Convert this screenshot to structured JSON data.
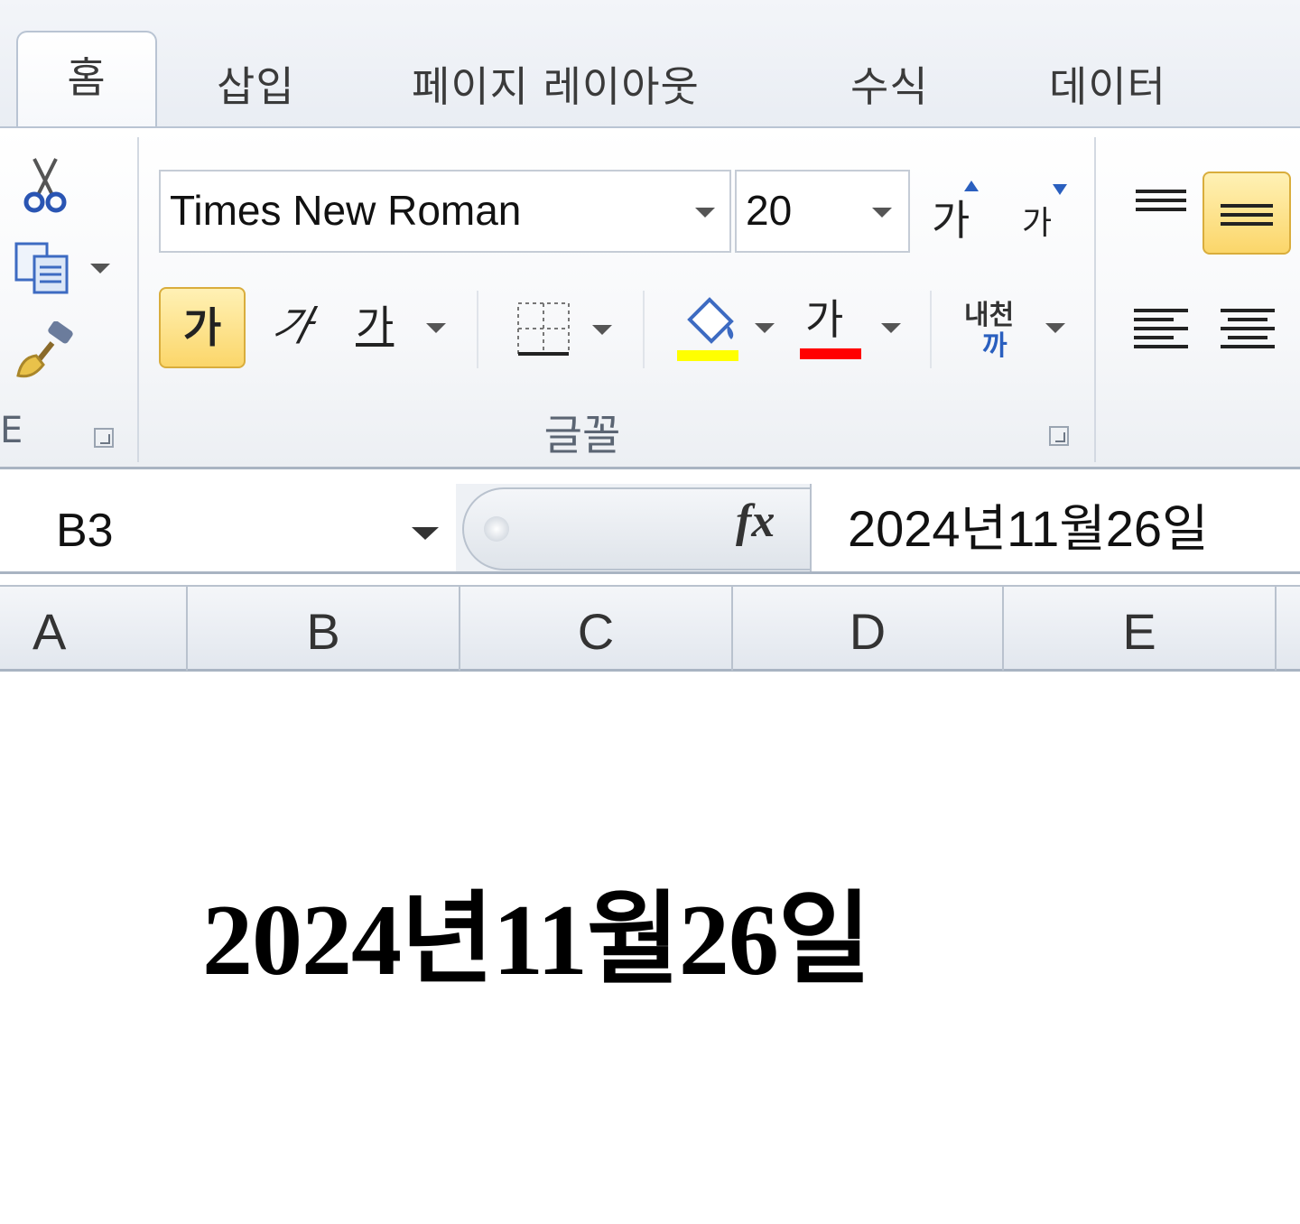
{
  "ribbon": {
    "tabs": [
      {
        "label": "홈",
        "active": true
      },
      {
        "label": "삽입"
      },
      {
        "label": "페이지 레이아웃"
      },
      {
        "label": "수식"
      },
      {
        "label": "데이터"
      }
    ],
    "font_group": {
      "font_name": "Times New Roman",
      "font_size": "20",
      "label": "글꼴",
      "grow_font_glyph": "가",
      "shrink_font_glyph": "가",
      "bold_glyph": "가",
      "italic_glyph": "가",
      "underline_glyph": "가",
      "font_color_glyph": "가",
      "phonetic_top": "내천",
      "phonetic_bottom": "까",
      "highlight_color": "#ffff00",
      "font_color": "#ff0000",
      "bold_active": true
    },
    "clipboard_group": {
      "label_fragment": "E"
    },
    "alignment_group": {
      "middle_align_active": true
    }
  },
  "formula_bar": {
    "name_box": "B3",
    "fx_label": "fx",
    "formula": "2024년11월26일"
  },
  "grid": {
    "columns": [
      "A",
      "B",
      "C",
      "D",
      "E"
    ],
    "cell_b3": "2024년11월26일"
  }
}
